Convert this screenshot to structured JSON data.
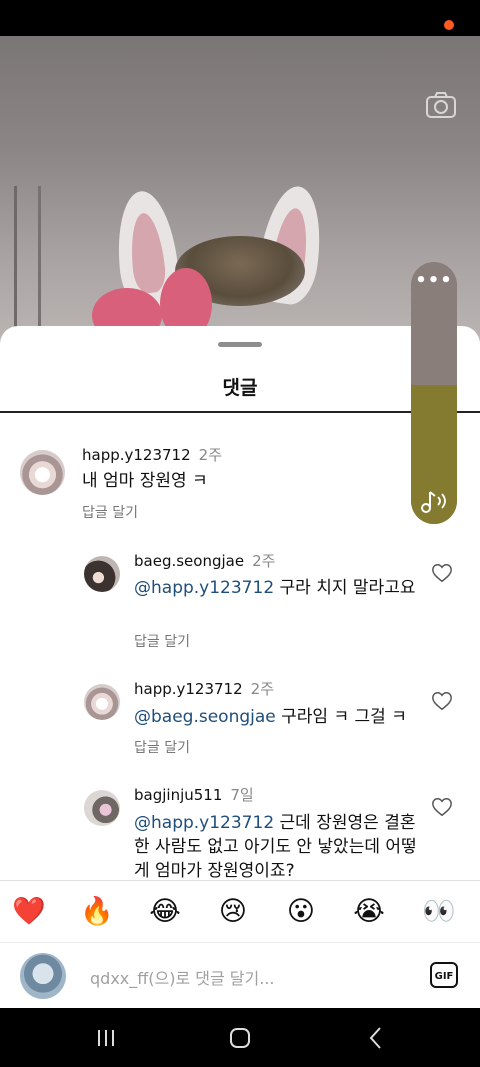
{
  "sheet": {
    "title": "댓글",
    "grabber": "drag-handle"
  },
  "icons": {
    "camera": "camera-icon",
    "volume_menu": "•••",
    "music": "music-note-icon",
    "heart": "heart-outline-icon",
    "gif": "GIF"
  },
  "comments": [
    {
      "username": "happ.y123712",
      "time": "2주",
      "mention": "",
      "text": "내 엄마 장원영 ㅋ",
      "reply_label": "답글 달기"
    },
    {
      "username": "baeg.seongjae",
      "time": "2주",
      "mention": "@happ.y123712",
      "text": " 구라 치지 말라고요",
      "reply_label": "답글 달기"
    },
    {
      "username": "happ.y123712",
      "time": "2주",
      "mention": "@baeg.seongjae",
      "text": " 구라임 ㅋ 그걸 ㅋ",
      "reply_label": "답글 달기"
    },
    {
      "username": "bagjinju511",
      "time": "7일",
      "mention": "@happ.y123712",
      "text": " 근데 장원영은 결혼한 사람도 없고 아기도 안 낳았는데 어떻게 엄마가 장원영이죠?",
      "reply_label": ""
    }
  ],
  "volume": {
    "level": 0.53
  },
  "emojis": [
    "❤️",
    "🔥",
    "😂",
    "😢",
    "😮",
    "😭",
    "👀"
  ],
  "input": {
    "placeholder": "qdxx_ff(으)로 댓글 달기..."
  },
  "colors": {
    "mention": "#1f4e7a",
    "volume_fill": "#847a30",
    "status_dot": "#ff5a1f"
  },
  "nav": {
    "recents": "recents-icon",
    "home": "home-icon",
    "back": "back-icon"
  }
}
